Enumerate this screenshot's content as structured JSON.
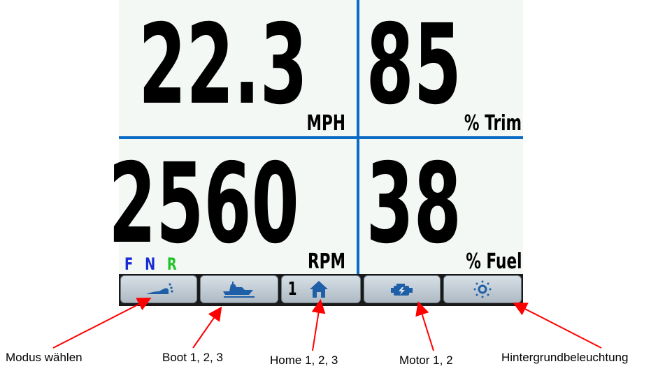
{
  "panels": {
    "speed": {
      "value": "22.3",
      "unit": "MPH"
    },
    "trim": {
      "value": "85",
      "unit": "% Trim"
    },
    "rpm": {
      "value": "2560",
      "unit": "RPM"
    },
    "fuel": {
      "value": "38",
      "unit": "% Fuel"
    }
  },
  "gear_indicator": [
    {
      "label": "F",
      "color": "#1a2bd6"
    },
    {
      "label": "N",
      "color": "#1a2bd6"
    },
    {
      "label": "R",
      "color": "#22c22a"
    }
  ],
  "buttons": [
    {
      "name": "mode-select-button",
      "icon": "boat-wake-icon"
    },
    {
      "name": "boat-button",
      "icon": "yacht-icon"
    },
    {
      "name": "home-button",
      "icon": "home-icon",
      "prefix": "1"
    },
    {
      "name": "engine-button",
      "icon": "engine-icon"
    },
    {
      "name": "backlight-button",
      "icon": "brightness-icon"
    }
  ],
  "callouts": {
    "mode": "Modus wählen",
    "boat": "Boot 1, 2, 3",
    "home": "Home 1, 2, 3",
    "motor": "Motor 1, 2",
    "backlight": "Hintergrundbeleuchtung"
  },
  "colors": {
    "accent": "#0a6cc4",
    "arrow": "#ff0000",
    "screen_bg": "#f3f8f5"
  }
}
